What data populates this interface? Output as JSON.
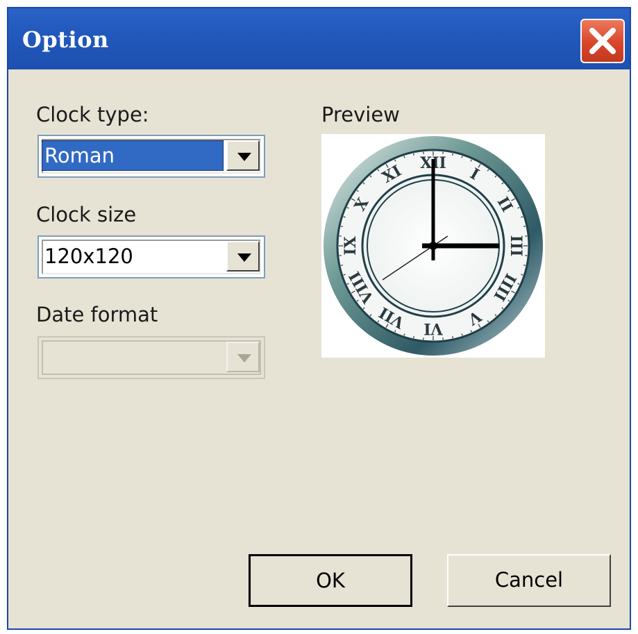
{
  "window": {
    "title": "Option"
  },
  "titlebar": {
    "close_icon": "close-x-icon"
  },
  "fields": {
    "clock_type": {
      "label": "Clock type:",
      "value": "Roman"
    },
    "clock_size": {
      "label": "Clock size",
      "value": "120x120"
    },
    "date_format": {
      "label": "Date format",
      "value": "",
      "enabled": false
    }
  },
  "preview": {
    "label": "Preview",
    "clock": {
      "style": "roman-numerals",
      "hour_hand_points_to": "3",
      "minute_hand_points_to": "12",
      "second_hand_points_to": "8"
    }
  },
  "buttons": {
    "ok": "OK",
    "cancel": "Cancel"
  },
  "colors": {
    "titlebar": "#2259bc",
    "dialog_bg": "#e6e2d4",
    "selection": "#316ac5",
    "close_button": "#d9452a"
  }
}
